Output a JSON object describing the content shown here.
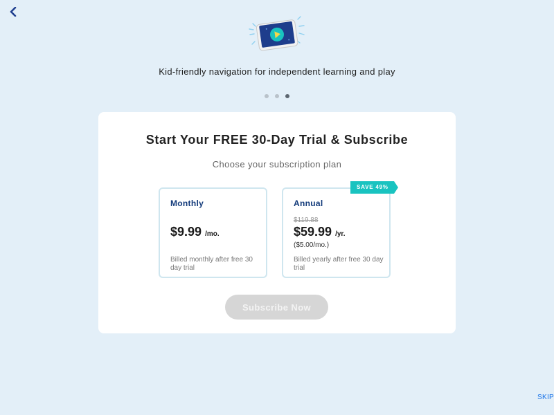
{
  "header": {
    "back_icon": "chevron-left-icon",
    "hero_icon": "tablet-play-icon"
  },
  "onboarding": {
    "tagline": "Kid-friendly navigation for independent learning and play",
    "page_count": 3,
    "active_page": 3
  },
  "paywall": {
    "title": "Start Your FREE 30-Day Trial & Subscribe",
    "subtitle": "Choose your subscription plan",
    "plans": [
      {
        "name": "Monthly",
        "price": "$9.99",
        "unit": "/mo.",
        "note": "Billed monthly after free 30 day trial"
      },
      {
        "name": "Annual",
        "old_price": "$119.88",
        "price": "$59.99",
        "unit": "/yr.",
        "monthly_equivalent": "($5.00/mo.)",
        "note": "Billed yearly after free 30 day trial",
        "badge": "SAVE 49%"
      }
    ],
    "subscribe_label": "Subscribe Now"
  },
  "footer": {
    "skip_label": "SKIP"
  },
  "colors": {
    "background": "#e3eff8",
    "plan_title": "#123a7a",
    "badge": "#19c3c0",
    "button_disabled": "#d6d6d6",
    "skip": "#1a73e8"
  }
}
